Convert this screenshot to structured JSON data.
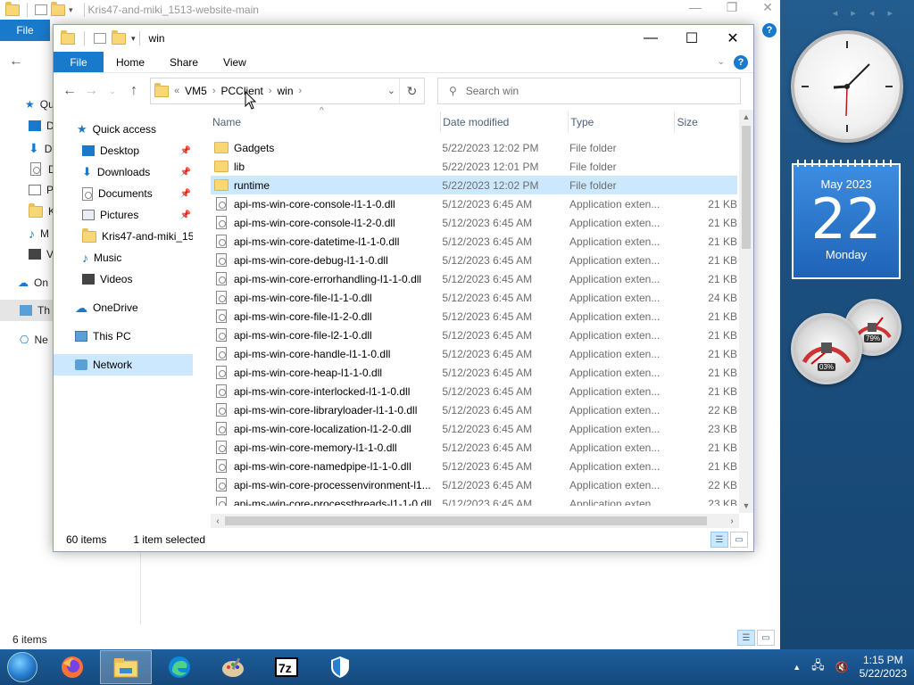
{
  "bg_window": {
    "title": "Kris47-and-miki_1513-website-main",
    "file_tab": "File",
    "status": "6 items",
    "nav": [
      "Qu",
      "D",
      "D",
      "D",
      "P",
      "K",
      "M",
      "V",
      "On",
      "Th",
      "Ne"
    ]
  },
  "window": {
    "title": "win",
    "ribbon": {
      "file": "File",
      "home": "Home",
      "share": "Share",
      "view": "View"
    },
    "address": {
      "overflow": "«",
      "crumbs": [
        "VM5",
        "PCClient",
        "win"
      ]
    },
    "search_placeholder": "Search win",
    "nav": [
      {
        "label": "Quick access",
        "icon": "star-icon",
        "pinned": false
      },
      {
        "label": "Desktop",
        "icon": "desktop-icon",
        "pinned": true
      },
      {
        "label": "Downloads",
        "icon": "downloads-icon",
        "pinned": true
      },
      {
        "label": "Documents",
        "icon": "documents-icon",
        "pinned": true
      },
      {
        "label": "Pictures",
        "icon": "pictures-icon",
        "pinned": true
      },
      {
        "label": "Kris47-and-miki_15",
        "icon": "folder-icon",
        "pinned": false
      },
      {
        "label": "Music",
        "icon": "music-icon",
        "pinned": false
      },
      {
        "label": "Videos",
        "icon": "videos-icon",
        "pinned": false
      },
      {
        "label": "OneDrive",
        "icon": "onedrive-icon",
        "pinned": false
      },
      {
        "label": "This PC",
        "icon": "this-pc-icon",
        "pinned": false
      },
      {
        "label": "Network",
        "icon": "network-icon",
        "pinned": false
      }
    ],
    "columns": {
      "name": "Name",
      "date": "Date modified",
      "type": "Type",
      "size": "Size"
    },
    "files": [
      {
        "name": "Gadgets",
        "date": "5/22/2023 12:02 PM",
        "type": "File folder",
        "size": "",
        "kind": "folder"
      },
      {
        "name": "lib",
        "date": "5/22/2023 12:01 PM",
        "type": "File folder",
        "size": "",
        "kind": "folder"
      },
      {
        "name": "runtime",
        "date": "5/22/2023 12:02 PM",
        "type": "File folder",
        "size": "",
        "kind": "folder",
        "selected": true
      },
      {
        "name": "api-ms-win-core-console-l1-1-0.dll",
        "date": "5/12/2023 6:45 AM",
        "type": "Application exten...",
        "size": "21 KB",
        "kind": "dll"
      },
      {
        "name": "api-ms-win-core-console-l1-2-0.dll",
        "date": "5/12/2023 6:45 AM",
        "type": "Application exten...",
        "size": "21 KB",
        "kind": "dll"
      },
      {
        "name": "api-ms-win-core-datetime-l1-1-0.dll",
        "date": "5/12/2023 6:45 AM",
        "type": "Application exten...",
        "size": "21 KB",
        "kind": "dll"
      },
      {
        "name": "api-ms-win-core-debug-l1-1-0.dll",
        "date": "5/12/2023 6:45 AM",
        "type": "Application exten...",
        "size": "21 KB",
        "kind": "dll"
      },
      {
        "name": "api-ms-win-core-errorhandling-l1-1-0.dll",
        "date": "5/12/2023 6:45 AM",
        "type": "Application exten...",
        "size": "21 KB",
        "kind": "dll"
      },
      {
        "name": "api-ms-win-core-file-l1-1-0.dll",
        "date": "5/12/2023 6:45 AM",
        "type": "Application exten...",
        "size": "24 KB",
        "kind": "dll"
      },
      {
        "name": "api-ms-win-core-file-l1-2-0.dll",
        "date": "5/12/2023 6:45 AM",
        "type": "Application exten...",
        "size": "21 KB",
        "kind": "dll"
      },
      {
        "name": "api-ms-win-core-file-l2-1-0.dll",
        "date": "5/12/2023 6:45 AM",
        "type": "Application exten...",
        "size": "21 KB",
        "kind": "dll"
      },
      {
        "name": "api-ms-win-core-handle-l1-1-0.dll",
        "date": "5/12/2023 6:45 AM",
        "type": "Application exten...",
        "size": "21 KB",
        "kind": "dll"
      },
      {
        "name": "api-ms-win-core-heap-l1-1-0.dll",
        "date": "5/12/2023 6:45 AM",
        "type": "Application exten...",
        "size": "21 KB",
        "kind": "dll"
      },
      {
        "name": "api-ms-win-core-interlocked-l1-1-0.dll",
        "date": "5/12/2023 6:45 AM",
        "type": "Application exten...",
        "size": "21 KB",
        "kind": "dll"
      },
      {
        "name": "api-ms-win-core-libraryloader-l1-1-0.dll",
        "date": "5/12/2023 6:45 AM",
        "type": "Application exten...",
        "size": "22 KB",
        "kind": "dll"
      },
      {
        "name": "api-ms-win-core-localization-l1-2-0.dll",
        "date": "5/12/2023 6:45 AM",
        "type": "Application exten...",
        "size": "23 KB",
        "kind": "dll"
      },
      {
        "name": "api-ms-win-core-memory-l1-1-0.dll",
        "date": "5/12/2023 6:45 AM",
        "type": "Application exten...",
        "size": "21 KB",
        "kind": "dll"
      },
      {
        "name": "api-ms-win-core-namedpipe-l1-1-0.dll",
        "date": "5/12/2023 6:45 AM",
        "type": "Application exten...",
        "size": "21 KB",
        "kind": "dll"
      },
      {
        "name": "api-ms-win-core-processenvironment-l1...",
        "date": "5/12/2023 6:45 AM",
        "type": "Application exten...",
        "size": "22 KB",
        "kind": "dll"
      },
      {
        "name": "api-ms-win-core-processthreads-l1-1-0.dll",
        "date": "5/12/2023 6:45 AM",
        "type": "Application exten...",
        "size": "23 KB",
        "kind": "dll"
      }
    ],
    "status": {
      "count": "60 items",
      "selection": "1 item selected"
    }
  },
  "gadgets": {
    "calendar": {
      "month": "May 2023",
      "day": "22",
      "weekday": "Monday"
    },
    "cpu": "03%",
    "mem": "79%"
  },
  "taskbar": {
    "apps": [
      "firefox-icon",
      "file-explorer-icon",
      "edge-icon",
      "paint-icon",
      "7zip-icon",
      "defender-icon"
    ],
    "time": "1:15 PM",
    "date": "5/22/2023"
  },
  "colors": {
    "accent": "#1979ca",
    "selection": "#cce8ff",
    "taskbar": "#1d5e9c"
  }
}
